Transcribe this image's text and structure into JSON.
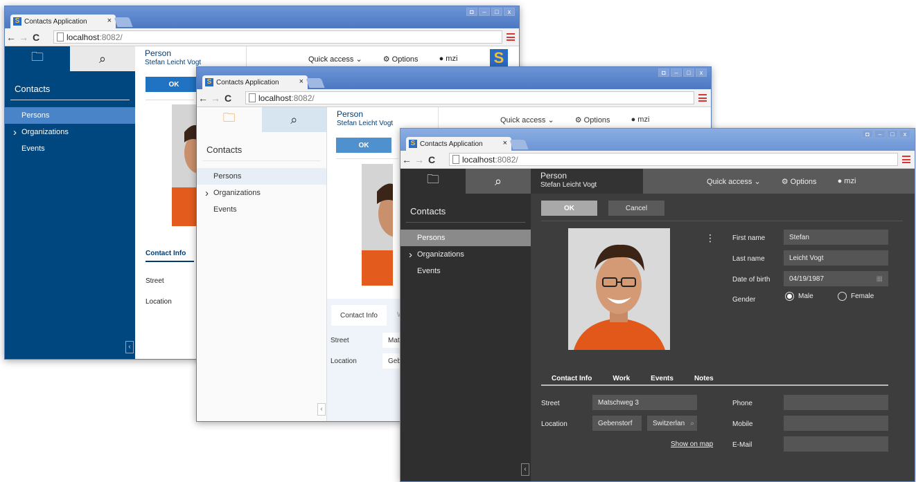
{
  "windows": [
    {
      "tab_title": "Contacts Application",
      "tab_close": "×",
      "url_host": "localhost",
      "url_port": ":8082/",
      "sidebar": {
        "title": "Contacts",
        "items": [
          "Persons",
          "Organizations",
          "Events"
        ]
      },
      "header": {
        "title": "Person",
        "subtitle": "Stefan Leicht Vogt",
        "quick_access": "Quick access",
        "options": "Options",
        "user": "mzi"
      },
      "form": {
        "ok": "OK",
        "tab_contact": "Contact Info",
        "street_label": "Street",
        "location_label": "Location"
      }
    },
    {
      "tab_title": "Contacts Application",
      "tab_close": "×",
      "url_host": "localhost",
      "url_port": ":8082/",
      "sidebar": {
        "title": "Contacts",
        "items": [
          "Persons",
          "Organizations",
          "Events"
        ]
      },
      "header": {
        "title": "Person",
        "subtitle": "Stefan Leicht Vogt",
        "quick_access": "Quick access",
        "options": "Options",
        "user": "mzi"
      },
      "form": {
        "ok": "OK",
        "tab_contact": "Contact Info",
        "tab_partial": "W",
        "street_label": "Street",
        "street_value": "Mats",
        "location_label": "Location",
        "location_value": "Gebe"
      }
    },
    {
      "tab_title": "Contacts Application",
      "tab_close": "×",
      "url_host": "localhost",
      "url_port": ":8082/",
      "sidebar": {
        "title": "Contacts",
        "items": [
          "Persons",
          "Organizations",
          "Events"
        ]
      },
      "header": {
        "title": "Person",
        "subtitle": "Stefan Leicht Vogt",
        "quick_access": "Quick access",
        "options": "Options",
        "user": "mzi"
      },
      "form": {
        "ok": "OK",
        "cancel": "Cancel",
        "first_name_label": "First name",
        "first_name": "Stefan",
        "last_name_label": "Last name",
        "last_name": "Leicht Vogt",
        "dob_label": "Date of birth",
        "dob": "04/19/1987",
        "gender_label": "Gender",
        "male": "Male",
        "female": "Female",
        "tabs": [
          "Contact Info",
          "Work",
          "Events",
          "Notes"
        ],
        "street_label": "Street",
        "street": "Matschweg 3",
        "location_label": "Location",
        "city": "Gebenstorf",
        "country": "Switzerlan",
        "show_on_map": "Show on map",
        "phone_label": "Phone",
        "mobile_label": "Mobile",
        "email_label": "E-Mail"
      }
    }
  ],
  "icons": [
    "folder-icon",
    "search-icon",
    "options-gear-icon",
    "user-icon",
    "chevron-down-icon",
    "calendar-icon",
    "more-vertical-icon",
    "collapse-left-icon"
  ],
  "colors": {
    "blue_theme": "#00467f",
    "blue_accent": "#4884c7",
    "dark_theme": "#3d3d3d",
    "light_accent": "#f08a28"
  }
}
